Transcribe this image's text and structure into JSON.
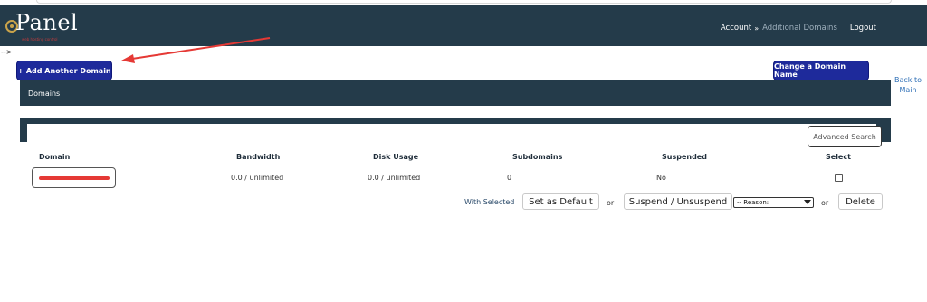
{
  "header": {
    "logo_text": "Panel",
    "logo_tagline": "web hosting control",
    "nav": {
      "account": "Account",
      "separator": "»",
      "current": "Additional Domains",
      "logout": "Logout"
    }
  },
  "stray_text": "-->",
  "actions": {
    "add_domain": "+ Add Another Domain",
    "change_domain": "Change a Domain Name",
    "back_line1": "Back to",
    "back_line2": "Main"
  },
  "section_title": "Domains",
  "advanced_search": "Advanced Search",
  "table": {
    "columns": [
      "Domain",
      "Bandwidth",
      "Disk Usage",
      "Subdomains",
      "Suspended",
      "Select"
    ],
    "rows": [
      {
        "domain": "",
        "bandwidth": "0.0 / unlimited",
        "disk_usage": "0.0 / unlimited",
        "subdomains": "0",
        "suspended": "No"
      }
    ]
  },
  "bulk": {
    "with_selected": "With Selected",
    "set_default": "Set as Default",
    "or": "or",
    "suspend_unsuspend": "Suspend / Unsuspend",
    "reason_selected": "-- Reason:",
    "delete": "Delete"
  },
  "colors": {
    "header_bg": "#243b4a",
    "primary_button": "#1e2a9b",
    "annotation_arrow": "#e53935",
    "link": "#2e6fb6"
  }
}
